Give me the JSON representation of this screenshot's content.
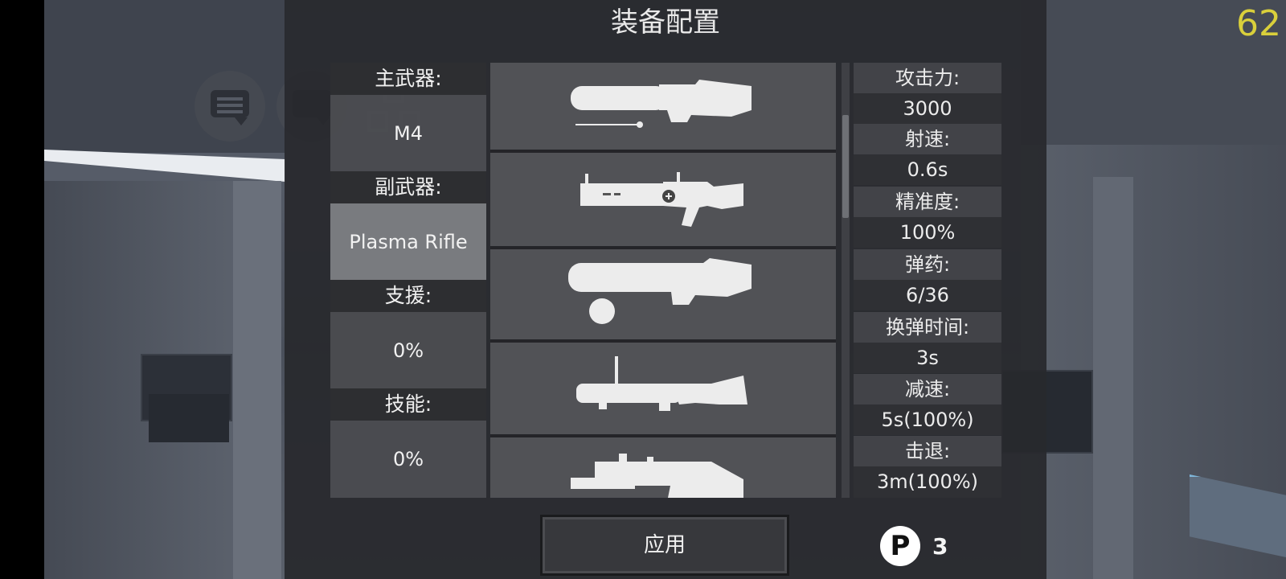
{
  "hud": {
    "fps": "62"
  },
  "title": "装备配置",
  "loadout": [
    {
      "label": "主武器:",
      "value": "M4"
    },
    {
      "label": "副武器:",
      "value": "Plasma Rifle"
    },
    {
      "label": "支援:",
      "value": "0%"
    },
    {
      "label": "技能:",
      "value": "0%"
    }
  ],
  "weapons": [
    {
      "icon": "assault-rifle-icon"
    },
    {
      "icon": "plasma-rifle-icon"
    },
    {
      "icon": "heavy-cannon-icon"
    },
    {
      "icon": "grenade-launcher-icon"
    },
    {
      "icon": "minigun-icon"
    }
  ],
  "stats": [
    {
      "label": "攻击力:",
      "value": "3000"
    },
    {
      "label": "射速:",
      "value": "0.6s"
    },
    {
      "label": "精准度:",
      "value": "100%"
    },
    {
      "label": "弹药:",
      "value": "6/36"
    },
    {
      "label": "换弹时间:",
      "value": "3s"
    },
    {
      "label": "减速:",
      "value": "5s(100%)"
    },
    {
      "label": "击退:",
      "value": "3m(100%)"
    }
  ],
  "apply_label": "应用",
  "points": {
    "icon_letter": "P",
    "value": "3"
  }
}
